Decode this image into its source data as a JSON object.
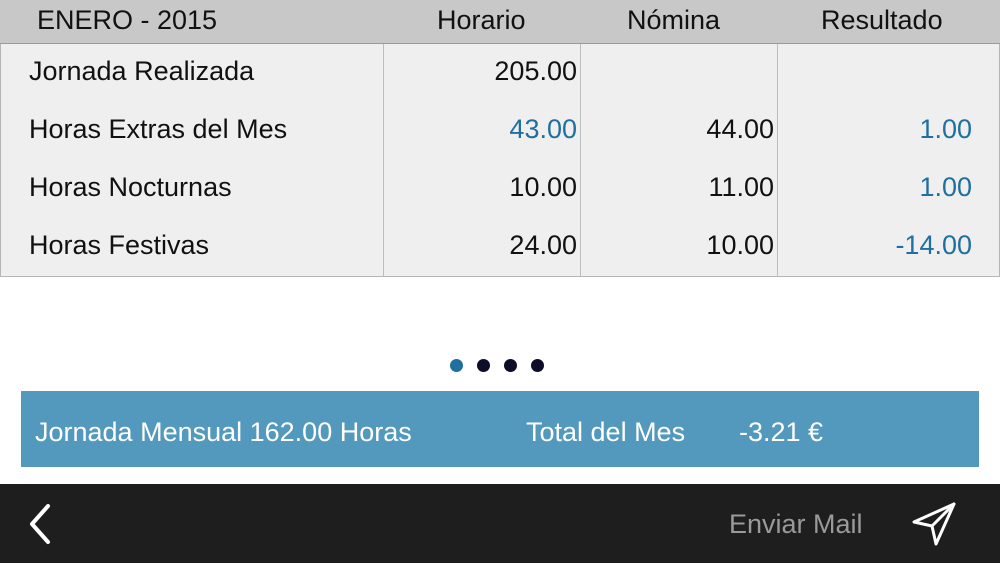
{
  "header": {
    "period": "ENERO - 2015",
    "col_horario": "Horario",
    "col_nomina": "Nómina",
    "col_resultado": "Resultado"
  },
  "rows": [
    {
      "label": "Jornada Realizada",
      "horario": "205.00",
      "nomina": "",
      "resultado": ""
    },
    {
      "label": "Horas Extras del Mes",
      "horario": "43.00",
      "nomina": "44.00",
      "resultado": "1.00"
    },
    {
      "label": "Horas Nocturnas",
      "horario": "10.00",
      "nomina": "11.00",
      "resultado": "1.00"
    },
    {
      "label": "Horas Festivas",
      "horario": "24.00",
      "nomina": "10.00",
      "resultado": "-14.00"
    }
  ],
  "pager": {
    "pages": 4,
    "current": 1
  },
  "summary": {
    "jornada": "Jornada Mensual 162.00 Horas",
    "total_label": "Total del Mes",
    "total_value": "-3.21 €"
  },
  "toolbar": {
    "back_icon": "chevron-left-icon",
    "send_label": "Enviar Mail",
    "send_icon": "paper-plane-icon"
  },
  "colors": {
    "accent": "#1f6fa0",
    "summary_bg": "#5398bd",
    "toolbar_bg": "#1e1e1e",
    "header_bg": "#c8c8c8",
    "table_bg": "#efefef"
  }
}
